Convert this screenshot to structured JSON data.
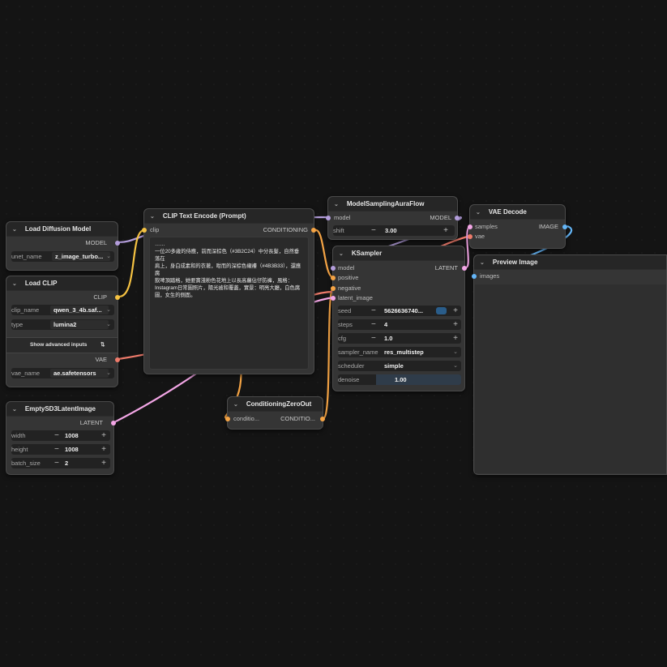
{
  "colors": {
    "model": "#b39ddb",
    "clip": "#f5c242",
    "vae": "#ef7b6b",
    "latent": "#f3a6e6",
    "conditioning": "#f5a445",
    "image": "#64b5f6"
  },
  "nodes": {
    "load_diffusion": {
      "title": "Load Diffusion Model",
      "out_model": "MODEL",
      "unet_name_label": "unet_name",
      "unet_name_value": "z_image_turbo..."
    },
    "load_clip": {
      "title": "Load CLIP",
      "out_clip": "CLIP",
      "clip_name_label": "clip_name",
      "clip_name_value": "qwen_3_4b.saf...",
      "type_label": "type",
      "type_value": "lumina2",
      "advanced_label": "Show advanced inputs",
      "out_vae": "VAE",
      "vae_name_label": "vae_name",
      "vae_name_value": "ae.safetensors"
    },
    "empty_latent": {
      "title": "EmptySD3LatentImage",
      "out_latent": "LATENT",
      "width_label": "width",
      "width_value": "1008",
      "height_label": "height",
      "height_value": "1008",
      "batch_label": "batch_size",
      "batch_value": "2"
    },
    "clip_text": {
      "title": "CLIP Text Encode (Prompt)",
      "in_clip": "clip",
      "out_conditioning": "CONDITIONING",
      "prompt_lines": [
        "……",
        "一位20多歲的侍應，前而深棕色（#3B2C24）中分長髮，自然垂落在",
        "肩上，身白成素和的衣著，咁而的深棕色襯褸（#4B3B33），還應腐",
        "飲啤頂踏格，她要寶淺粉色花地上以長高蘿佔仔防褲，風格：",
        "Instagram日常圖照片，陽光被和覆蓋，實景：明亮大廳，白色腐",
        "圖，女生的側面。"
      ]
    },
    "cond_zero": {
      "title": "ConditioningZeroOut",
      "in_label": "conditio...",
      "out_label": "CONDITIO..."
    },
    "model_sampling": {
      "title": "ModelSamplingAuraFlow",
      "in_model": "model",
      "out_model": "MODEL",
      "shift_label": "shift",
      "shift_value": "3.00"
    },
    "ksampler": {
      "title": "KSampler",
      "in_model": "model",
      "in_positive": "positive",
      "in_negative": "negative",
      "in_latent": "latent_image",
      "out_latent": "LATENT",
      "seed_label": "seed",
      "seed_value": "5626636740...",
      "steps_label": "steps",
      "steps_value": "4",
      "cfg_label": "cfg",
      "cfg_value": "1.0",
      "sampler_label": "sampler_name",
      "sampler_value": "res_multistep",
      "scheduler_label": "scheduler",
      "scheduler_value": "simple",
      "denoise_label": "denoise",
      "denoise_value": "1.00"
    },
    "vae_decode": {
      "title": "VAE Decode",
      "in_samples": "samples",
      "in_vae": "vae",
      "out_image": "IMAGE"
    },
    "preview": {
      "title": "Preview Image",
      "in_images": "images"
    }
  }
}
